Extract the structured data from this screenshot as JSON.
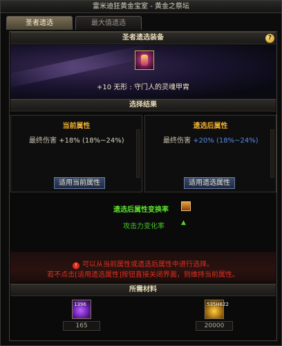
{
  "window": {
    "title": "雷米迪狂黄金宝室 - 黄金之祭坛"
  },
  "tabs": [
    {
      "label": "圣者遗选",
      "active": true
    },
    {
      "label": "最大值遗选",
      "active": false
    }
  ],
  "equipment": {
    "header": "圣者遗选装备",
    "name": "+10 无形 : 守门人的灵魂甲胄",
    "icon": "armor-icon"
  },
  "results": {
    "header": "选择结果",
    "current": {
      "title": "当前属性",
      "stat_label": "最终伤害",
      "stat_value": "+18% (18%~24%)",
      "button": "适用当前属性"
    },
    "after": {
      "title": "遗选后属性",
      "stat_label": "最终伤害",
      "stat_value": "+20% (18%~24%)",
      "button": "适用遗选属性"
    }
  },
  "rate": {
    "title": "遗选后属性变换率",
    "row_label": "攻击力变化率",
    "row_indicator": "▲",
    "icon": "scroll-icon"
  },
  "notice": {
    "line1": "可以从当前属性或遗选后属性中进行选择。",
    "line2": "若不点击[适用遗选属性]按钮直接关闭界面，则维持当前属性。",
    "icon": "warning-icon"
  },
  "materials": {
    "header": "所需材料",
    "items": [
      {
        "icon": "purple-crystal-icon",
        "count": "1396",
        "required": "165"
      },
      {
        "icon": "gold-coin-icon",
        "count": "535H822",
        "required": "20000"
      }
    ]
  },
  "colors": {
    "accent_gold": "#f0b030",
    "stat_up_blue": "#5a8ae8",
    "rate_green": "#5ae02a",
    "warning_red": "#e03020"
  }
}
